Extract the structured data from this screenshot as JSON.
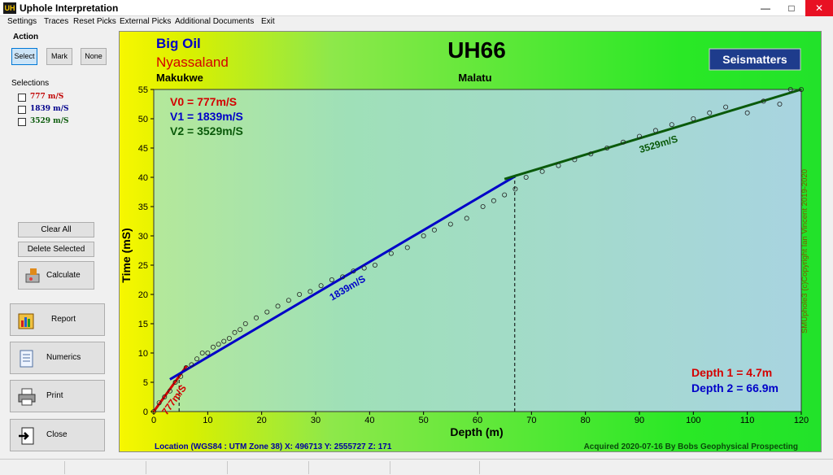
{
  "window": {
    "title": "Uphole Interpretation",
    "app_icon_text": "UH",
    "minimize": "—",
    "maximize": "□",
    "close": "✕"
  },
  "menu": [
    "Settings",
    "Traces",
    "Reset Picks",
    "External Picks",
    "Additional Documents",
    "Exit"
  ],
  "action": {
    "label": "Action",
    "buttons": [
      "Select",
      "Mark",
      "None"
    ],
    "active": "Select"
  },
  "selections": {
    "label": "Selections",
    "items": [
      {
        "label": "777 m/S",
        "color": "#c00000",
        "checked": false
      },
      {
        "label": "1839 m/S",
        "color": "#00008b",
        "checked": false
      },
      {
        "label": "3529 m/S",
        "color": "#0a5a0a",
        "checked": false
      }
    ]
  },
  "buttons": {
    "clear_all": "Clear All",
    "delete_selected": "Delete Selected",
    "calculate": "Calculate",
    "report": "Report",
    "numerics": "Numerics",
    "print": "Print",
    "close": "Close"
  },
  "plot": {
    "company": "Big Oil",
    "region": "Nyassaland",
    "title": "UH66",
    "left_location": "Makukwe",
    "right_location": "Malatu",
    "logo": "Seismatters",
    "velocities": [
      {
        "label": "V0 = 777m/S",
        "color": "#d40000"
      },
      {
        "label": "V1 = 1839m/S",
        "color": "#0000c8"
      },
      {
        "label": "V2 = 3529m/S",
        "color": "#0a5a0a"
      }
    ],
    "depths": [
      {
        "label": "Depth 1 = 4.7m",
        "color": "#d40000"
      },
      {
        "label": "Depth 2 = 66.9m",
        "color": "#0000c8"
      }
    ],
    "copyright": "SMUphole3 (c)Copyright Ian Vincent 2019-2020",
    "location_text": "Location (WGS84 : UTM Zone 38) X: 496713 Y: 2555727 Z: 171",
    "acquired_text": "Acquired 2020-07-16 By Bobs Geophysical Prospecting"
  },
  "chart_data": {
    "type": "scatter",
    "xlabel": "Depth (m)",
    "ylabel": "Time (mS)",
    "xlim": [
      0,
      120
    ],
    "ylim": [
      0,
      55
    ],
    "x_ticks": [
      0,
      10,
      20,
      30,
      40,
      50,
      60,
      70,
      80,
      90,
      100,
      110,
      120
    ],
    "y_ticks": [
      0,
      5,
      10,
      15,
      20,
      25,
      30,
      35,
      40,
      45,
      50,
      55
    ],
    "points": [
      [
        0,
        0
      ],
      [
        1,
        1.5
      ],
      [
        2,
        2.5
      ],
      [
        3,
        3.5
      ],
      [
        4,
        5
      ],
      [
        5,
        6
      ],
      [
        6,
        7.5
      ],
      [
        7,
        8
      ],
      [
        8,
        9
      ],
      [
        9,
        10
      ],
      [
        10,
        10
      ],
      [
        11,
        11
      ],
      [
        12,
        11.5
      ],
      [
        13,
        12
      ],
      [
        14,
        12.5
      ],
      [
        15,
        13.5
      ],
      [
        16,
        14
      ],
      [
        17,
        15
      ],
      [
        19,
        16
      ],
      [
        21,
        17
      ],
      [
        23,
        18
      ],
      [
        25,
        19
      ],
      [
        27,
        20
      ],
      [
        29,
        20.5
      ],
      [
        31,
        21.5
      ],
      [
        33,
        22.5
      ],
      [
        35,
        23
      ],
      [
        37,
        24
      ],
      [
        39,
        24.5
      ],
      [
        41,
        25
      ],
      [
        44,
        27
      ],
      [
        47,
        28
      ],
      [
        50,
        30
      ],
      [
        52,
        31
      ],
      [
        55,
        32
      ],
      [
        58,
        33
      ],
      [
        61,
        35
      ],
      [
        63,
        36
      ],
      [
        65,
        37
      ],
      [
        67,
        38
      ],
      [
        69,
        40
      ],
      [
        72,
        41
      ],
      [
        75,
        42
      ],
      [
        78,
        43
      ],
      [
        81,
        44
      ],
      [
        84,
        45
      ],
      [
        87,
        46
      ],
      [
        90,
        47
      ],
      [
        93,
        48
      ],
      [
        96,
        49
      ],
      [
        100,
        50
      ],
      [
        103,
        51
      ],
      [
        106,
        52
      ],
      [
        110,
        51
      ],
      [
        113,
        53
      ],
      [
        116,
        52.5
      ],
      [
        118,
        55
      ],
      [
        120,
        55
      ]
    ],
    "fit_lines": [
      {
        "name": "777m/S",
        "color": "#d40000",
        "x": [
          0,
          6.1
        ],
        "y": [
          0,
          7.8
        ]
      },
      {
        "name": "1839m/S",
        "color": "#0000c8",
        "x": [
          3,
          67
        ],
        "y": [
          5.5,
          40.2
        ]
      },
      {
        "name": "3529m/S",
        "color": "#0a5a0a",
        "x": [
          65,
          120
        ],
        "y": [
          39.7,
          55
        ]
      }
    ],
    "depth_markers": [
      {
        "x": 4.7,
        "label": "Depth 1"
      },
      {
        "x": 66.9,
        "label": "Depth 2"
      }
    ],
    "grid": false
  }
}
